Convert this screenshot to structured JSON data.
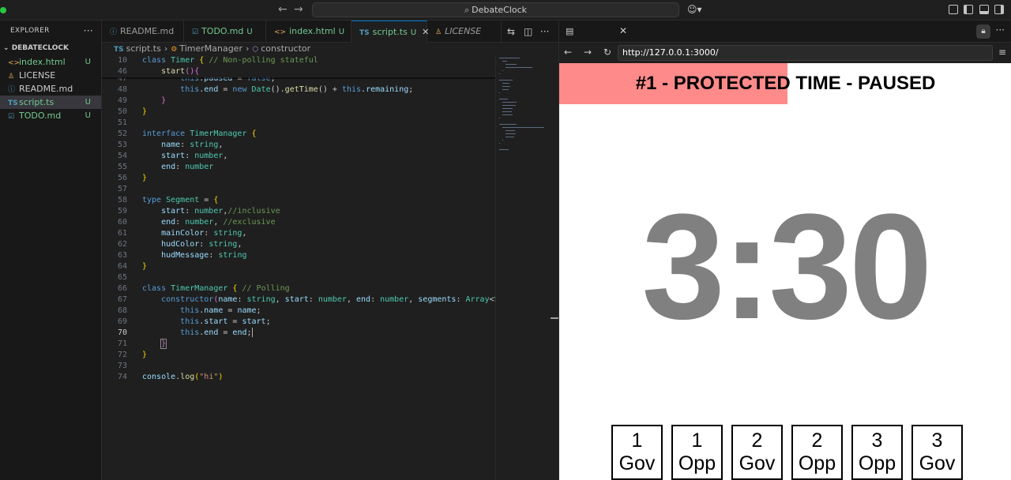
{
  "titlebar": {
    "command_center": "DebateClock"
  },
  "explorer": {
    "header": "EXPLORER",
    "folder": "DEBATECLOCK",
    "files": [
      {
        "name": "index.html",
        "icon": "<>",
        "status": "U",
        "color": "#73c991"
      },
      {
        "name": "LICENSE",
        "icon": "license-icon",
        "status": "",
        "color": "#cccccc"
      },
      {
        "name": "README.md",
        "icon": "info-icon",
        "status": "",
        "color": "#cccccc"
      },
      {
        "name": "script.ts",
        "icon": "TS",
        "status": "U",
        "color": "#73c991"
      },
      {
        "name": "TODO.md",
        "icon": "todo-icon",
        "status": "U",
        "color": "#73c991"
      }
    ]
  },
  "editor": {
    "tabs": [
      {
        "label": "README.md",
        "status": ""
      },
      {
        "label": "TODO.md",
        "status": "U"
      },
      {
        "label": "index.html",
        "status": "U"
      },
      {
        "label": "script.ts",
        "status": "U"
      },
      {
        "label": "LICENSE",
        "status": ""
      }
    ],
    "breadcrumb": [
      "script.ts",
      "TimerManager",
      "constructor"
    ],
    "lines": [
      {
        "n": "10",
        "html": "<span class='k'>class</span> <span class='c'>Timer</span> <span class='b1'>{</span> <span class='cm'>// Non-polling stateful</span>"
      },
      {
        "n": "46",
        "html": "    <span class='f'>start</span><span class='b2'>()</span><span class='b2'>{</span>"
      },
      {
        "n": "47",
        "html": "        <span class='k'>this</span>.<span class='v'>paused</span> = <span class='k'>false</span>;"
      },
      {
        "n": "48",
        "html": "        <span class='k'>this</span>.<span class='v'>end</span> = <span class='k'>new</span> <span class='c'>Date</span>().<span class='f'>getTime</span>() + <span class='k'>this</span>.<span class='v'>remaining</span>;"
      },
      {
        "n": "49",
        "html": "    <span class='b2'>}</span>"
      },
      {
        "n": "50",
        "html": "<span class='b1'>}</span>"
      },
      {
        "n": "51",
        "html": ""
      },
      {
        "n": "52",
        "html": "<span class='k'>interface</span> <span class='c'>TimerManager</span> <span class='b1'>{</span>"
      },
      {
        "n": "53",
        "html": "    <span class='v'>name</span>: <span class='c'>string</span>,"
      },
      {
        "n": "54",
        "html": "    <span class='v'>start</span>: <span class='c'>number</span>,"
      },
      {
        "n": "55",
        "html": "    <span class='v'>end</span>: <span class='c'>number</span>"
      },
      {
        "n": "56",
        "html": "<span class='b1'>}</span>"
      },
      {
        "n": "57",
        "html": ""
      },
      {
        "n": "58",
        "html": "<span class='k'>type</span> <span class='c'>Segment</span> = <span class='b1'>{</span>"
      },
      {
        "n": "59",
        "html": "    <span class='v'>start</span>: <span class='c'>number</span>,<span class='cm'>//inclusive</span>"
      },
      {
        "n": "60",
        "html": "    <span class='v'>end</span>: <span class='c'>number</span>, <span class='cm'>//exclusive</span>"
      },
      {
        "n": "61",
        "html": "    <span class='v'>mainColor</span>: <span class='c'>string</span>,"
      },
      {
        "n": "62",
        "html": "    <span class='v'>hudColor</span>: <span class='c'>string</span>,"
      },
      {
        "n": "63",
        "html": "    <span class='v'>hudMessage</span>: <span class='c'>string</span>"
      },
      {
        "n": "64",
        "html": "<span class='b1'>}</span>"
      },
      {
        "n": "65",
        "html": ""
      },
      {
        "n": "66",
        "html": "<span class='k'>class</span> <span class='c'>TimerManager</span> <span class='b1'>{</span> <span class='cm'>// Polling</span>"
      },
      {
        "n": "67",
        "html": "    <span class='k'>constructor</span><span class='b2'>(</span><span class='v'>name</span>: <span class='c'>string</span>, <span class='v'>start</span>: <span class='c'>number</span>, <span class='v'>end</span>: <span class='c'>number</span>, <span class='v'>segments</span>: <span class='c'>Array</span>&lt;<span class='c'>Segmen</span>"
      },
      {
        "n": "68",
        "html": "        <span class='k'>this</span>.<span class='v'>name</span> = <span class='v'>name</span>;"
      },
      {
        "n": "69",
        "html": "        <span class='k'>this</span>.<span class='v'>start</span> = <span class='v'>start</span>;"
      },
      {
        "n": "70",
        "html": "        <span class='k'>this</span>.<span class='v'>end</span> = <span class='v'>end</span>;<span class='cursor'></span>"
      },
      {
        "n": "71",
        "html": "    <span class='b2 bracket-match'>}</span>"
      },
      {
        "n": "72",
        "html": "<span class='b1'>}</span>"
      },
      {
        "n": "73",
        "html": ""
      },
      {
        "n": "74",
        "html": "<span class='v'>console</span>.<span class='f'>log</span><span class='b1'>(</span><span class='s'>\"hi\"</span><span class='b1'>)</span>"
      }
    ],
    "current_line": "70"
  },
  "browser": {
    "url": "http://127.0.0.1:3000/",
    "hud_message": "#1 - PROTECTED TIME - PAUSED",
    "hud_color": "#ff8a8a",
    "progress_fraction": 0.505,
    "timer": "3:30",
    "timer_color": "#808080",
    "speakers": [
      {
        "num": "1",
        "side": "Gov"
      },
      {
        "num": "1",
        "side": "Opp"
      },
      {
        "num": "2",
        "side": "Gov"
      },
      {
        "num": "2",
        "side": "Opp"
      },
      {
        "num": "3",
        "side": "Opp"
      },
      {
        "num": "3",
        "side": "Gov"
      }
    ]
  }
}
